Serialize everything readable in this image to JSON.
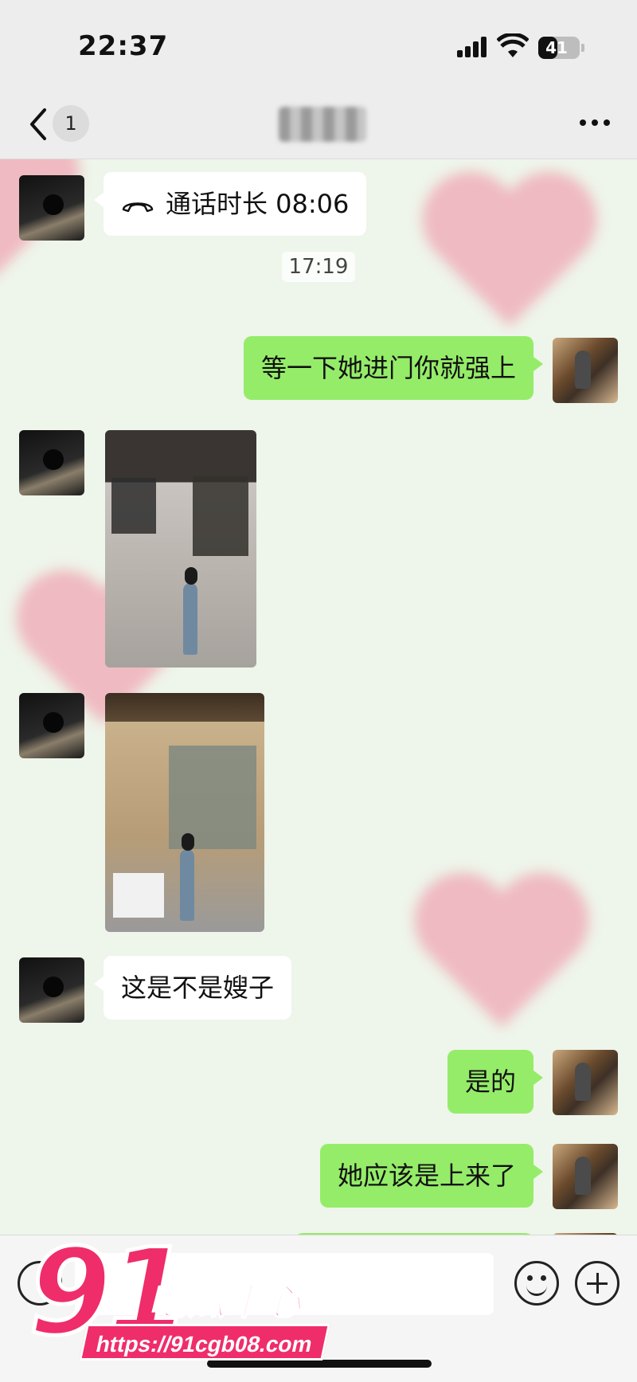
{
  "status_bar": {
    "time": "22:37",
    "battery": "41"
  },
  "nav": {
    "unread_count": "1",
    "chat_title": "■■■■"
  },
  "messages": {
    "call_duration": "通话时长 08:06",
    "timestamp": "17:19",
    "out_1": "等一下她进门你就强上",
    "in_1": "这是不是嫂子",
    "out_2": "是的",
    "out_3": "她应该是上来了"
  },
  "watermark": {
    "digits": "91",
    "brand": "吃瓜中心",
    "url": "https://91cgb08.com"
  },
  "colors": {
    "outgoing_bubble": "#95ec69",
    "incoming_bubble": "#ffffff",
    "background": "#eef5ea",
    "watermark": "#ef2d6a"
  },
  "icons": [
    "back-icon",
    "more-icon",
    "call-icon",
    "voice-icon",
    "emoji-icon",
    "plus-icon"
  ]
}
